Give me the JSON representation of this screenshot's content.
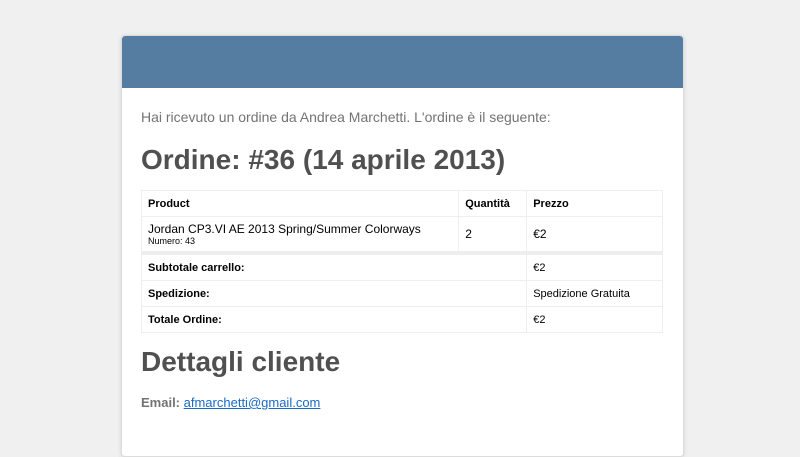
{
  "colors": {
    "header": "#557da1",
    "link": "#1a6ac7",
    "page_background": "#f0f0f0"
  },
  "intro": "Hai ricevuto un ordine da Andrea Marchetti. L'ordine è il seguente:",
  "order": {
    "heading": "Ordine: #36 (14 aprile 2013)",
    "columns": [
      "Product",
      "Quantità",
      "Prezzo"
    ],
    "items": [
      {
        "name": "Jordan CP3.VI AE 2013 Spring/Summer Colorways",
        "meta": "Numero: 43",
        "quantity": "2",
        "price": "€2"
      }
    ],
    "totals": [
      {
        "label": "Subtotale carrello:",
        "value": "€2"
      },
      {
        "label": "Spedizione:",
        "value": "Spedizione Gratuita"
      },
      {
        "label": "Totale Ordine:",
        "value": "€2"
      }
    ]
  },
  "customer": {
    "heading": "Dettagli cliente",
    "email_label": "Email:",
    "email": "afmarchetti@gmail.com"
  }
}
